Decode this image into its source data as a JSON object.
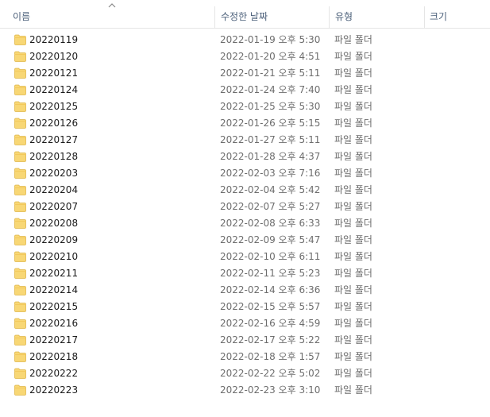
{
  "columns": {
    "name": "이름",
    "date_modified": "수정한 날짜",
    "type": "유형",
    "size": "크기"
  },
  "sort": {
    "column": "name",
    "direction": "ascending",
    "icon": "chevron-up-icon"
  },
  "folder_icon": "folder-icon",
  "colors": {
    "folder": "#f8d775",
    "header_text": "#4c607a",
    "detail_text": "#6d6d6d"
  },
  "files": [
    {
      "name": "20220119",
      "date": "2022-01-19 오후 5:30",
      "type": "파일 폴더",
      "size": ""
    },
    {
      "name": "20220120",
      "date": "2022-01-20 오후 4:51",
      "type": "파일 폴더",
      "size": ""
    },
    {
      "name": "20220121",
      "date": "2022-01-21 오후 5:11",
      "type": "파일 폴더",
      "size": ""
    },
    {
      "name": "20220124",
      "date": "2022-01-24 오후 7:40",
      "type": "파일 폴더",
      "size": ""
    },
    {
      "name": "20220125",
      "date": "2022-01-25 오후 5:30",
      "type": "파일 폴더",
      "size": ""
    },
    {
      "name": "20220126",
      "date": "2022-01-26 오후 5:15",
      "type": "파일 폴더",
      "size": ""
    },
    {
      "name": "20220127",
      "date": "2022-01-27 오후 5:11",
      "type": "파일 폴더",
      "size": ""
    },
    {
      "name": "20220128",
      "date": "2022-01-28 오후 4:37",
      "type": "파일 폴더",
      "size": ""
    },
    {
      "name": "20220203",
      "date": "2022-02-03 오후 7:16",
      "type": "파일 폴더",
      "size": ""
    },
    {
      "name": "20220204",
      "date": "2022-02-04 오후 5:42",
      "type": "파일 폴더",
      "size": ""
    },
    {
      "name": "20220207",
      "date": "2022-02-07 오후 5:27",
      "type": "파일 폴더",
      "size": ""
    },
    {
      "name": "20220208",
      "date": "2022-02-08 오후 6:33",
      "type": "파일 폴더",
      "size": ""
    },
    {
      "name": "20220209",
      "date": "2022-02-09 오후 5:47",
      "type": "파일 폴더",
      "size": ""
    },
    {
      "name": "20220210",
      "date": "2022-02-10 오후 6:11",
      "type": "파일 폴더",
      "size": ""
    },
    {
      "name": "20220211",
      "date": "2022-02-11 오후 5:23",
      "type": "파일 폴더",
      "size": ""
    },
    {
      "name": "20220214",
      "date": "2022-02-14 오후 6:36",
      "type": "파일 폴더",
      "size": ""
    },
    {
      "name": "20220215",
      "date": "2022-02-15 오후 5:57",
      "type": "파일 폴더",
      "size": ""
    },
    {
      "name": "20220216",
      "date": "2022-02-16 오후 4:59",
      "type": "파일 폴더",
      "size": ""
    },
    {
      "name": "20220217",
      "date": "2022-02-17 오후 5:22",
      "type": "파일 폴더",
      "size": ""
    },
    {
      "name": "20220218",
      "date": "2022-02-18 오후 1:57",
      "type": "파일 폴더",
      "size": ""
    },
    {
      "name": "20220222",
      "date": "2022-02-22 오후 5:02",
      "type": "파일 폴더",
      "size": ""
    },
    {
      "name": "20220223",
      "date": "2022-02-23 오후 3:10",
      "type": "파일 폴더",
      "size": ""
    }
  ]
}
